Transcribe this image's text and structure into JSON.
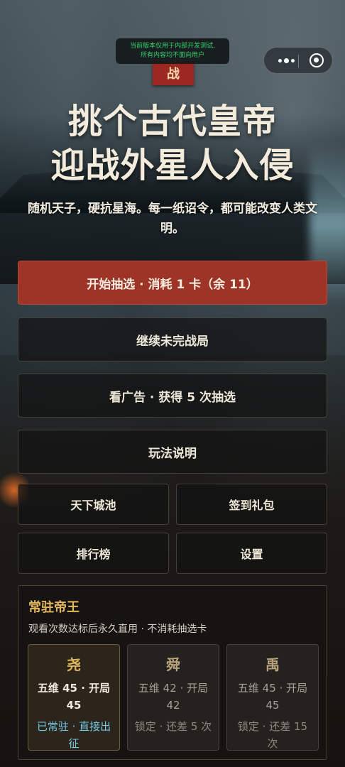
{
  "dev_notice": {
    "line1": "当前版本仅用于内部开发测试,",
    "line2": "所有内容均不面向用户"
  },
  "seal_text": "战",
  "title": {
    "line1": "挑个古代皇帝",
    "line2": "迎战外星人入侵"
  },
  "subtitle": "随机天子，硬抗星海。每一纸诏令，都可能改变人类文明。",
  "buttons": {
    "start": "开始抽选 · 消耗 1 卡（余 11）",
    "continue": "继续未完战局",
    "watch_ad": "看广告 · 获得 5 次抽选",
    "how_to_play": "玩法说明",
    "cities": "天下城池",
    "checkin": "签到礼包",
    "leaderboard": "排行榜",
    "settings": "设置"
  },
  "resident": {
    "title": "常驻帝王",
    "description": "观看次数达标后永久直用 · 不消耗抽选卡",
    "cards": [
      {
        "name": "尧",
        "stats": "五维 45 · 开局 45",
        "status": "已常驻 · 直接出征",
        "locked": false
      },
      {
        "name": "舜",
        "stats": "五维 42 · 开局 42",
        "status": "锁定 · 还差 5 次",
        "locked": true
      },
      {
        "name": "禹",
        "stats": "五维 45 · 开局 45",
        "status": "锁定 · 还差 15 次",
        "locked": true
      }
    ]
  },
  "colors": {
    "primary_button": "#9e3428",
    "accent_gold": "#e3b85d",
    "unlocked_status": "#74c8e6",
    "dev_notice_text": "#35d26c"
  },
  "icons": {
    "capsule_more": "more-dots-icon",
    "capsule_close": "target-circle-icon"
  }
}
